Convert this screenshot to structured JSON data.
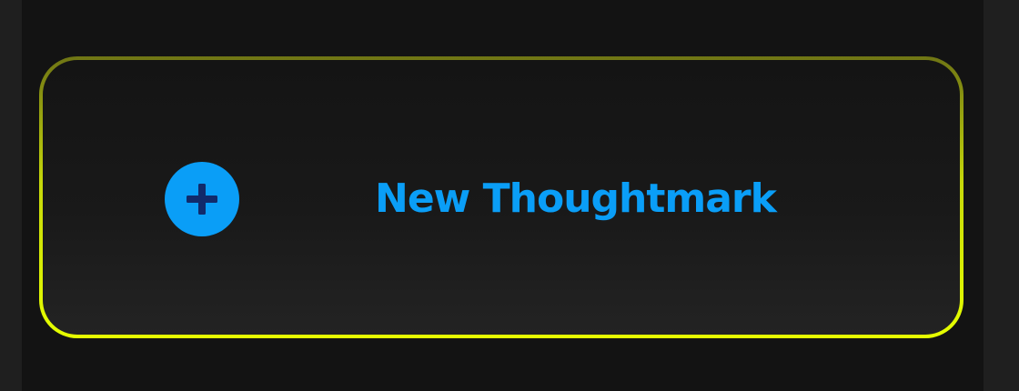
{
  "new_thoughtmark": {
    "label": "New Thoughtmark",
    "icon": "plus-circle-icon"
  },
  "colors": {
    "accent_blue": "#0a9ef7",
    "icon_plus": "#112a6b",
    "border_glow": "#e6ff00",
    "panel_background": "#131313",
    "outer_background": "#1f1f1f"
  }
}
